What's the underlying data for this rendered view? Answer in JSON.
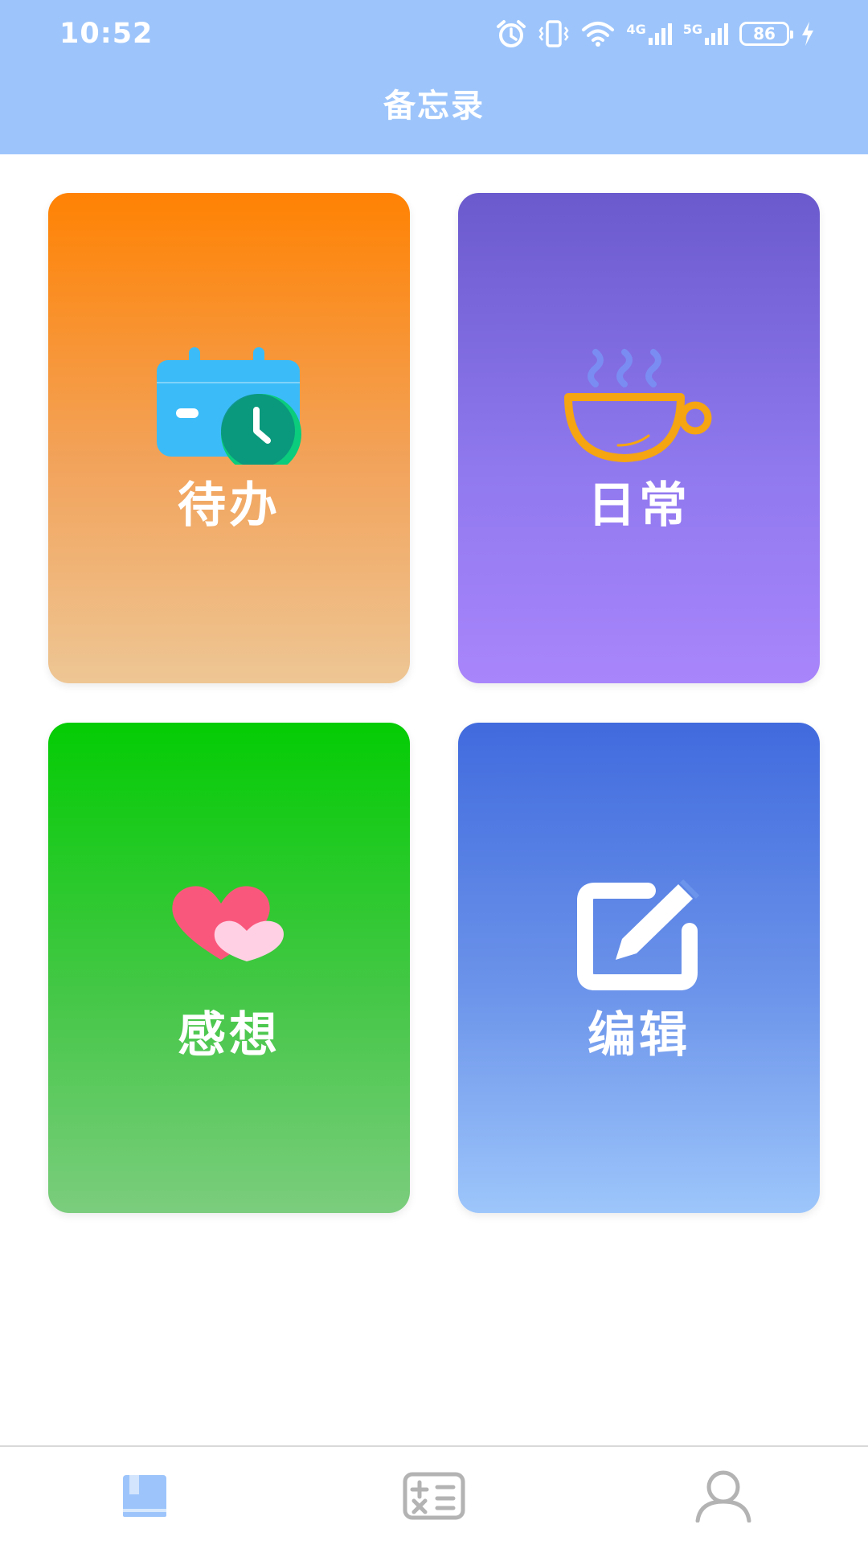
{
  "status_bar": {
    "time": "10:52",
    "network_1": "4G",
    "network_2": "5G",
    "battery": "86"
  },
  "header": {
    "title": "备忘录",
    "background_color": "#9dc5fb"
  },
  "cards": [
    {
      "label": "待办",
      "icon": "calendar-clock-icon",
      "gradient": [
        "#ff8203",
        "#eec694"
      ]
    },
    {
      "label": "日常",
      "icon": "coffee-cup-icon",
      "gradient": [
        "#6a5acd",
        "#a985fb"
      ]
    },
    {
      "label": "感想",
      "icon": "hearts-icon",
      "gradient": [
        "#04cc04",
        "#7bcd7d"
      ]
    },
    {
      "label": "编辑",
      "icon": "edit-icon",
      "gradient": [
        "#416bde",
        "#9dc6fb"
      ]
    }
  ],
  "tabbar": {
    "active_color": "#9dc5fb",
    "inactive_color": "#b3b3b3",
    "tabs": [
      {
        "icon": "book-icon",
        "active": true
      },
      {
        "icon": "calculator-icon",
        "active": false
      },
      {
        "icon": "user-icon",
        "active": false
      }
    ]
  }
}
